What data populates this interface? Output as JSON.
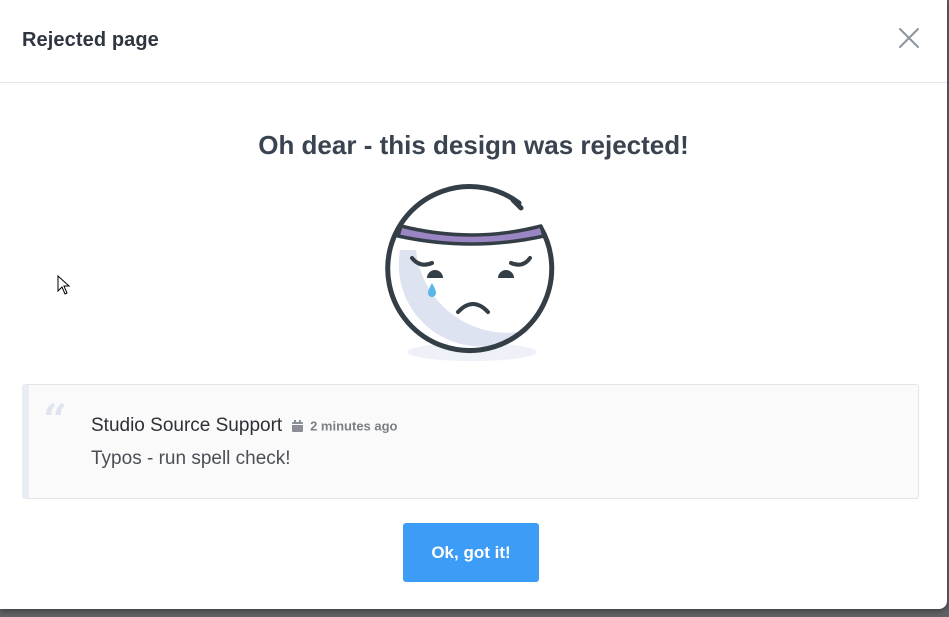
{
  "modal": {
    "title": "Rejected page",
    "close_icon": "close-icon",
    "headline": "Oh dear - this design was rejected!",
    "illustration": "sad-face-illustration"
  },
  "comment": {
    "quote_icon": "quote-icon",
    "author": "Studio Source Support",
    "calendar_icon": "calendar-icon",
    "timestamp": "2 minutes ago",
    "text": "Typos - run spell check!"
  },
  "actions": {
    "ok_label": "Ok, got it!"
  },
  "colors": {
    "accent": "#3d9df6",
    "headband": "#9b86c4",
    "tear": "#5bb7e8",
    "face_outline": "#343e46",
    "face_shadow": "#dde3f0"
  }
}
